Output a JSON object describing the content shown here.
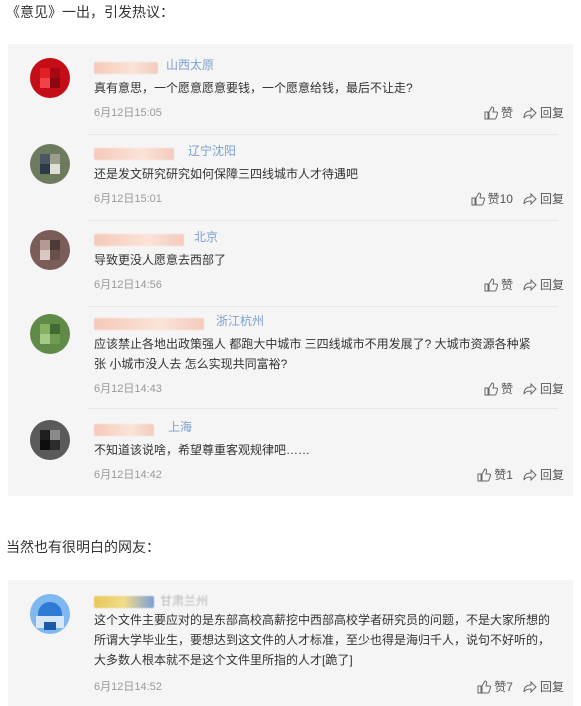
{
  "headings": {
    "first": "《意见》一出，引发热议：",
    "second": "当然也有很明白的网友："
  },
  "comments": [
    {
      "location": "山西太原",
      "text": "真有意思，一个愿意愿意要钱，一个愿意给钱，最后不让走?",
      "time": "6月12日15:05",
      "like_label": "赞",
      "reply_label": "回复",
      "avatar_colors": [
        "#c40d16",
        "#e21f26",
        "#a70812",
        "#f24148"
      ]
    },
    {
      "location": "辽宁沈阳",
      "text": "还是发文研究研究如何保障三四线城市人才待遇吧",
      "time": "6月12日15:01",
      "like_label": "赞10",
      "reply_label": "回复",
      "avatar_colors": [
        "#6c7a5d",
        "#4a5763",
        "#9aa08c",
        "#2d3a46"
      ]
    },
    {
      "location": "北京",
      "text": "导致更没人愿意去西部了",
      "time": "6月12日14:56",
      "like_label": "赞",
      "reply_label": "回复",
      "avatar_colors": [
        "#7a5d59",
        "#b39a93",
        "#4d3a37",
        "#d8c8c2"
      ]
    },
    {
      "location": "浙江杭州",
      "text_line1": "应该禁止各地出政策强人 都跑大中城市 三四线城市不用发展了? 大城市资源各种紧",
      "text_line2": "张 小城市没人去 怎么实现共同富裕?",
      "time": "6月12日14:43",
      "like_label": "赞",
      "reply_label": "回复",
      "avatar_colors": [
        "#5f8a48",
        "#87b05f",
        "#3f6a32",
        "#a7c886"
      ]
    },
    {
      "location": "上海",
      "text": "不知道该说啥，希望尊重客观规律吧……",
      "time": "6月12日14:42",
      "like_label": "赞1",
      "reply_label": "回复",
      "avatar_colors": [
        "#1e1e1e",
        "#5a5a5a",
        "#0e0e0e",
        "#8a8a8a"
      ]
    }
  ],
  "extra_comment": {
    "location": "甘肃兰州",
    "text_line1": "这个文件主要应对的是东部高校高薪挖中西部高校学者研究员的问题，不是大家所想的",
    "text_line2": "所谓大学毕业生，要想达到这文件的人才标准，至少也得是海归千人，说句不好听的，",
    "text_line3": "大多数人根本就不是这个文件里所指的人才[跪了]",
    "time": "6月12日14:52",
    "like_label": "赞7",
    "reply_label": "回复",
    "avatar_colors": [
      "#2e7bd3",
      "#7fb7ef",
      "#d7e7f7",
      "#1b5aa8"
    ]
  }
}
